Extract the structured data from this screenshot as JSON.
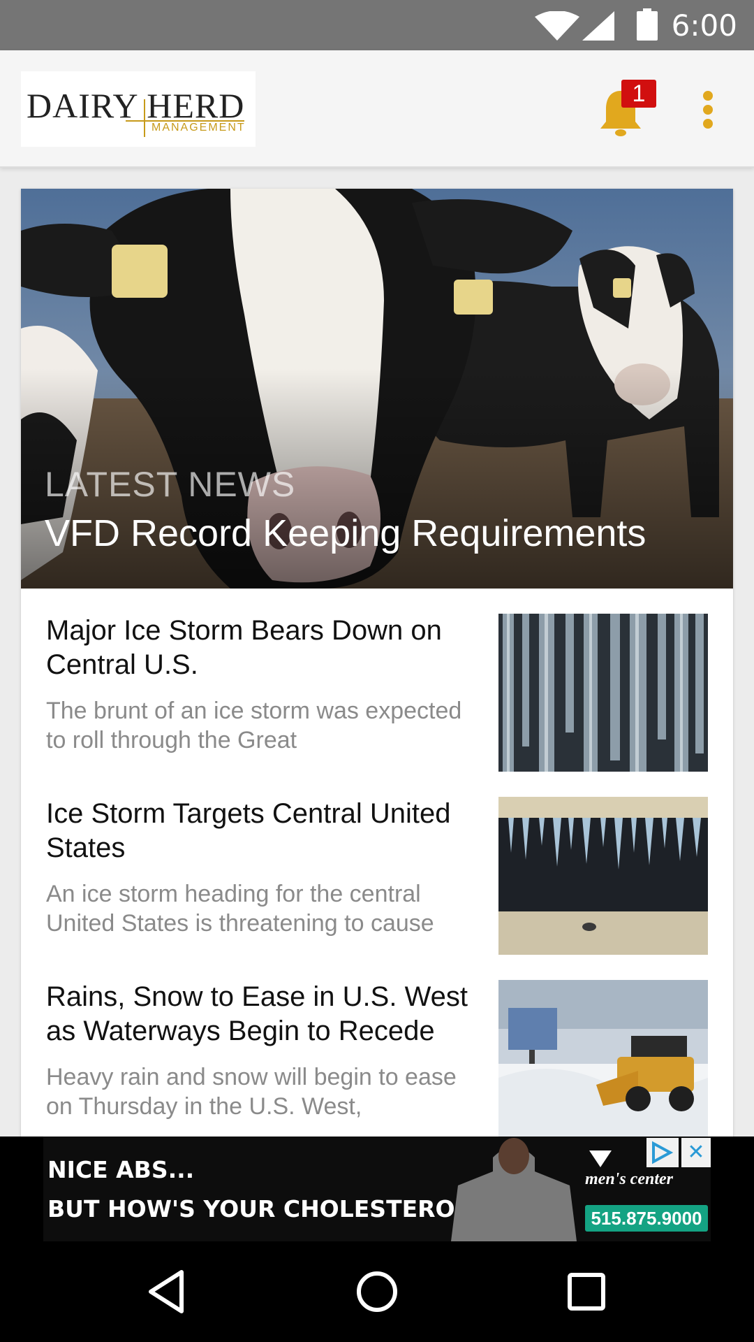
{
  "status_bar": {
    "time": "6:00"
  },
  "app_bar": {
    "logo_line1": "DAIRY HERD",
    "logo_line2": "MANAGEMENT",
    "notification_count": "1"
  },
  "featured": {
    "kicker": "LATEST NEWS",
    "headline": "VFD Record Keeping Requirements"
  },
  "articles": [
    {
      "title": "Major Ice Storm Bears Down on Central U.S.",
      "summary": "The brunt of an ice storm was expected to roll through the Great"
    },
    {
      "title": "Ice Storm Targets Central United States",
      "summary": "An ice storm heading for the central United States is threatening to cause"
    },
    {
      "title": "Rains, Snow to Ease in U.S. West as Waterways Begin to Recede",
      "summary": "Heavy rain and snow will begin to ease on Thursday in the U.S. West,"
    }
  ],
  "ad": {
    "line1": "NICE ABS...",
    "line2": "BUT HOW'S YOUR CHOLESTEROL?",
    "brand": "men's center",
    "phone": "515.875.9000"
  },
  "icons": {
    "status": [
      "wifi-icon",
      "cell-signal-icon",
      "battery-icon"
    ],
    "nav": [
      "back-icon",
      "home-icon",
      "recents-icon"
    ]
  },
  "colors": {
    "accent": "#e1a81e",
    "badge": "#d10f0f",
    "status_bar": "#757575"
  }
}
